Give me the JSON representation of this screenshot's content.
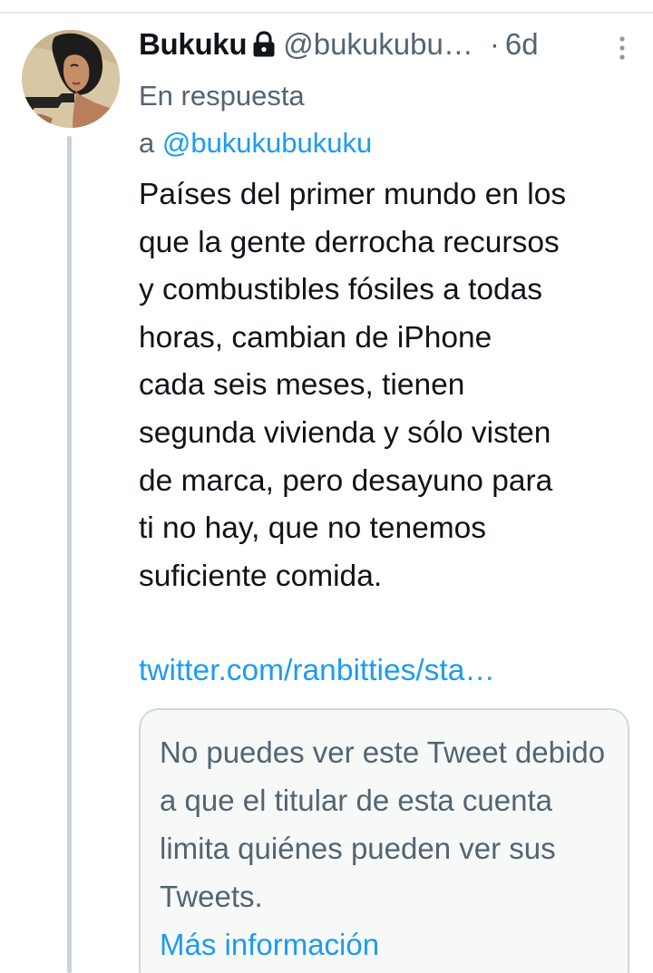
{
  "tweet": {
    "display_name": "Bukuku",
    "handle": "@bukukubu…",
    "separator": "·",
    "time": "6d",
    "reply_prefix": "En respuesta",
    "reply_a": "a ",
    "reply_mention": "@bukukubukuku",
    "text": "Países del primer mundo en los\nque la gente derrocha recursos\ny combustibles fósiles a todas\nhoras, cambian de iPhone\ncada seis meses, tienen\nsegunda vivienda y sólo visten\nde marca, pero desayuno para\nti no hay, que no tenemos\nsuficiente comida.",
    "link": "twitter.com/ranbitties/sta…"
  },
  "quoted_tweet": {
    "message": "No puedes ver este Tweet debido a que el titular de esta cuenta limita quiénes pueden ver sus Tweets.",
    "more_info_label": "Más información"
  },
  "icons": {
    "lock": "lock-icon",
    "more": "more-vertical-icon",
    "avatar": "avatar-image"
  },
  "colors": {
    "link": "#1d9bf0",
    "secondary_text": "#536471",
    "primary_text": "#0f1419",
    "thread_line": "#c9d3db",
    "card_border": "#cfd9de",
    "card_background": "#f7f9f9"
  }
}
